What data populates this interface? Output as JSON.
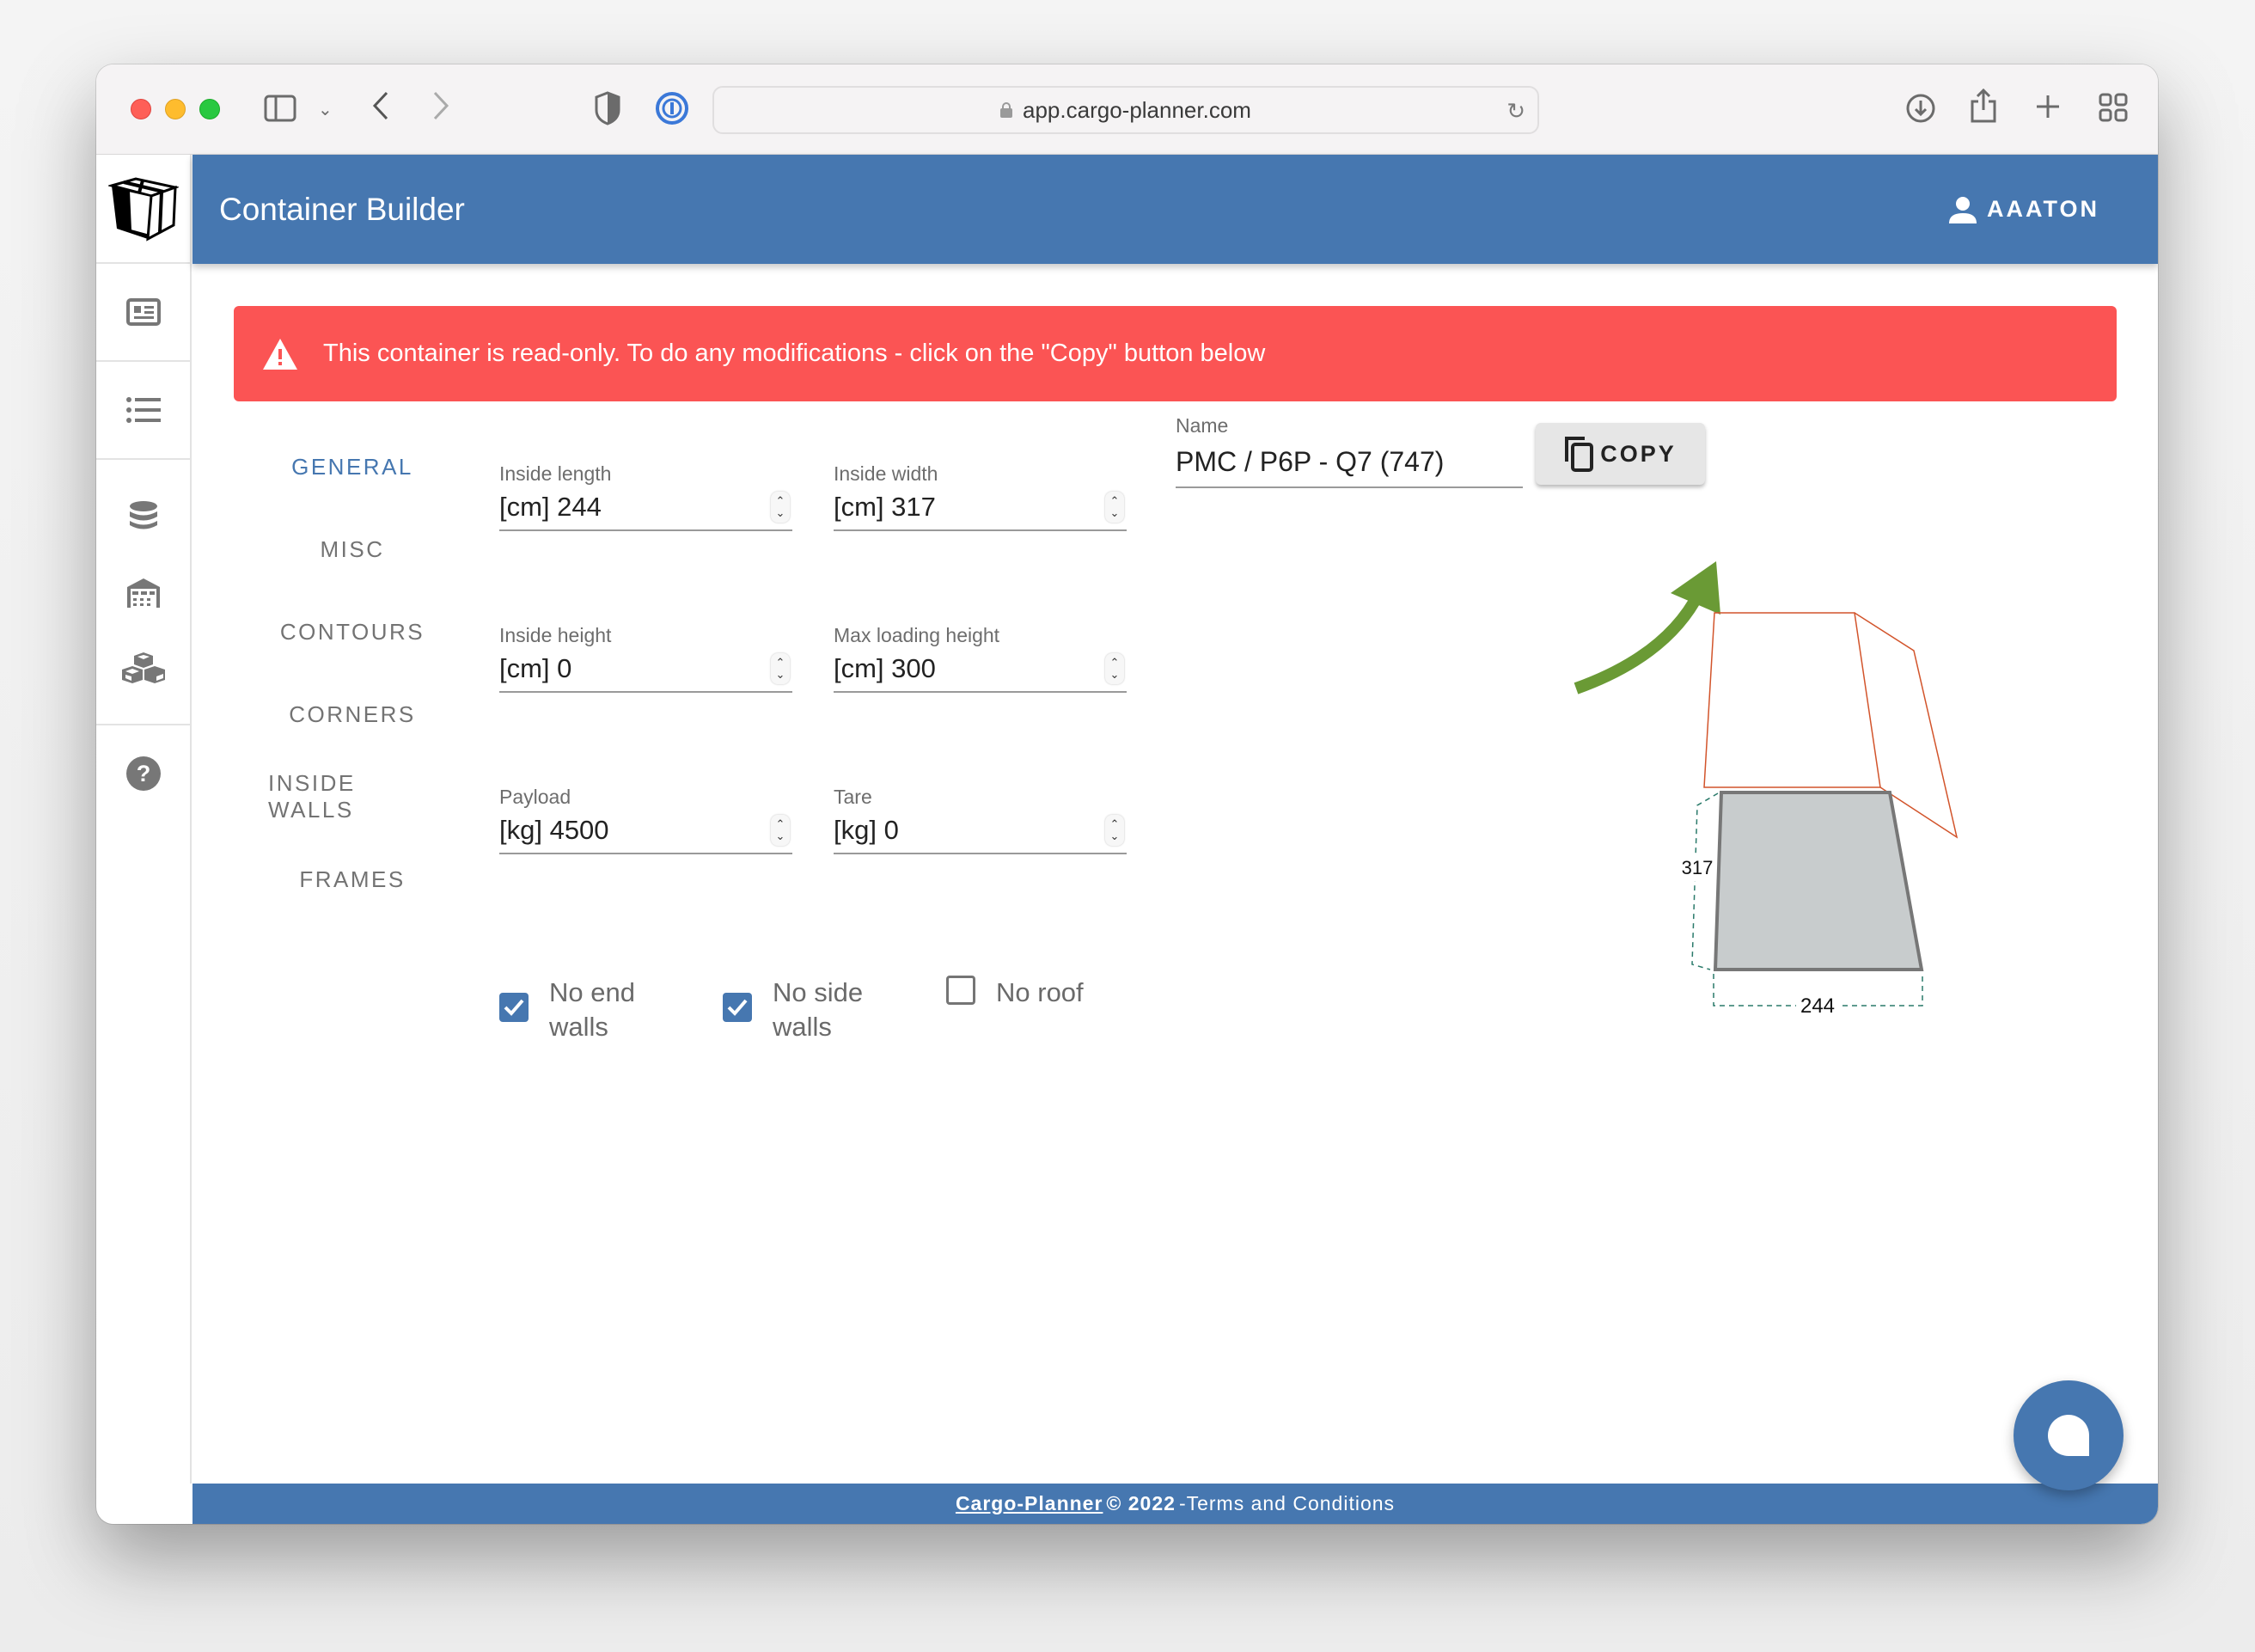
{
  "browser": {
    "url": "app.cargo-planner.com",
    "icons": [
      "sidebar-toggle-icon",
      "chevron-down-icon",
      "back-icon",
      "forward-icon",
      "privacy-shield-icon",
      "password-manager-icon",
      "lock-icon",
      "reload-icon",
      "download-icon",
      "share-icon",
      "new-tab-icon",
      "tab-overview-icon"
    ]
  },
  "header": {
    "title": "Container Builder",
    "user": "AAATON"
  },
  "sidebar": {
    "items": [
      {
        "icon": "app-logo-box-icon"
      },
      {
        "icon": "loadplans-card-icon"
      },
      {
        "icon": "list-icon"
      },
      {
        "icon": "database-icon"
      },
      {
        "icon": "warehouse-icon"
      },
      {
        "icon": "cargo-boxes-icon"
      },
      {
        "icon": "help-icon"
      }
    ]
  },
  "alert": {
    "message": "This container is read-only. To do any modifications - click on the \"Copy\" button below",
    "color": "#fb5454"
  },
  "tabs": [
    {
      "label": "GENERAL",
      "active": true
    },
    {
      "label": "MISC",
      "active": false
    },
    {
      "label": "CONTOURS",
      "active": false
    },
    {
      "label": "CORNERS",
      "active": false
    },
    {
      "label": "INSIDE WALLS",
      "active": false
    },
    {
      "label": "FRAMES",
      "active": false
    }
  ],
  "fields": {
    "inside_length": {
      "label": "Inside length",
      "value": "[cm] 244"
    },
    "inside_width": {
      "label": "Inside width",
      "value": "[cm] 317"
    },
    "inside_height": {
      "label": "Inside height",
      "value": "[cm] 0"
    },
    "max_loading_height": {
      "label": "Max loading height",
      "value": "[cm] 300"
    },
    "payload": {
      "label": "Payload",
      "value": "[kg] 4500"
    },
    "tare": {
      "label": "Tare",
      "value": "[kg] 0"
    }
  },
  "checkboxes": [
    {
      "label": "No end walls",
      "checked": true
    },
    {
      "label": "No side walls",
      "checked": true
    },
    {
      "label": "No roof",
      "checked": false
    }
  ],
  "name": {
    "label": "Name",
    "value": "PMC / P6P - Q7 (747)"
  },
  "copy_button": {
    "label": "COPY"
  },
  "diagram": {
    "width_label": "317",
    "length_label": "244"
  },
  "footer": {
    "brand": "Cargo-Planner",
    "copyright": "© 2022",
    "terms": "-Terms and Conditions"
  },
  "colors": {
    "primary": "#4677b0",
    "alert": "#fb5454",
    "annotation_arrow": "#6a9a35"
  }
}
